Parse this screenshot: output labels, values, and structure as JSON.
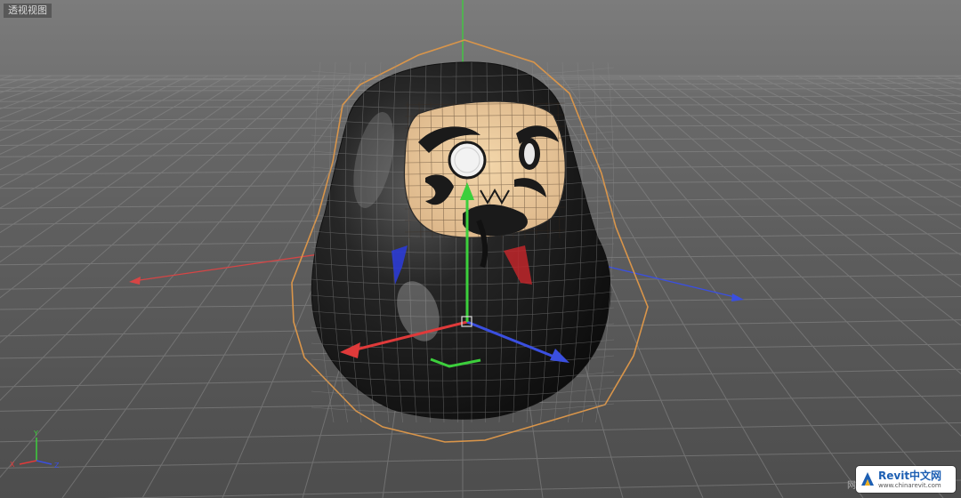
{
  "viewport": {
    "label": "透视视图",
    "background_color": "#6b6b6b",
    "grid_color": "#8a8a8a",
    "axis_colors": {
      "x": "#e03a3a",
      "y": "#3ccf3c",
      "z": "#3a4fe0"
    },
    "selection_color": "#d9954a"
  },
  "axis_indicator": {
    "x_label": "X",
    "y_label": "Y",
    "z_label": "Z"
  },
  "watermark": {
    "title": "Revit中文网",
    "url": "www.chinarevit.com",
    "prefix": "网"
  },
  "object": {
    "name": "daruma-doll",
    "icons": [
      "move-gizmo",
      "bounding-cage"
    ]
  }
}
